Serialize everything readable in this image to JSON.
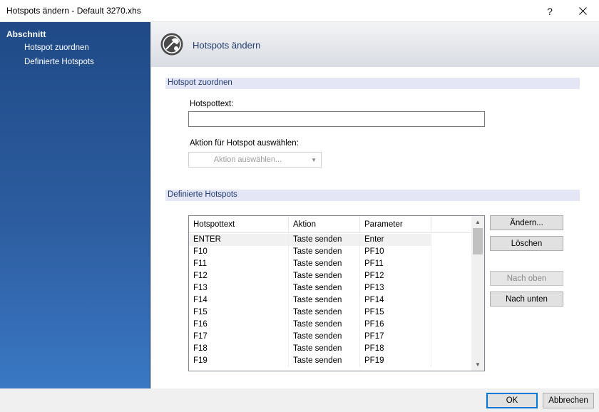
{
  "window": {
    "title": "Hotspots ändern - Default 3270.xhs",
    "help": "?"
  },
  "nav": {
    "heading": "Abschnitt",
    "items": [
      "Hotspot zuordnen",
      "Definierte Hotspots"
    ]
  },
  "header": {
    "title": "Hotspots ändern",
    "icon": "hotspot-edit-icon"
  },
  "section1": {
    "title": "Hotspot zuordnen",
    "hotspottext_label": "Hotspottext:",
    "hotspottext_value": "",
    "action_label": "Aktion für Hotspot auswählen:",
    "action_value": "Aktion auswählen..."
  },
  "section2": {
    "title": "Definierte Hotspots",
    "columns": [
      "Hotspottext",
      "Aktion",
      "Parameter"
    ],
    "rows": [
      [
        "ENTER",
        "Taste senden",
        "Enter"
      ],
      [
        "F10",
        "Taste senden",
        "PF10"
      ],
      [
        "F11",
        "Taste senden",
        "PF11"
      ],
      [
        "F12",
        "Taste senden",
        "PF12"
      ],
      [
        "F13",
        "Taste senden",
        "PF13"
      ],
      [
        "F14",
        "Taste senden",
        "PF14"
      ],
      [
        "F15",
        "Taste senden",
        "PF15"
      ],
      [
        "F16",
        "Taste senden",
        "PF16"
      ],
      [
        "F17",
        "Taste senden",
        "PF17"
      ],
      [
        "F18",
        "Taste senden",
        "PF18"
      ],
      [
        "F19",
        "Taste senden",
        "PF19"
      ]
    ],
    "buttons": {
      "aendern": "Ändern...",
      "loeschen": "Löschen",
      "nach_oben": "Nach oben",
      "nach_unten": "Nach unten"
    }
  },
  "footer": {
    "ok": "OK",
    "abbrechen": "Abbrechen"
  },
  "colors": {
    "accent": "#0078d7",
    "nav": "#2d5da0",
    "section": "#e4e6f6",
    "heading_text": "#1f3b70"
  }
}
